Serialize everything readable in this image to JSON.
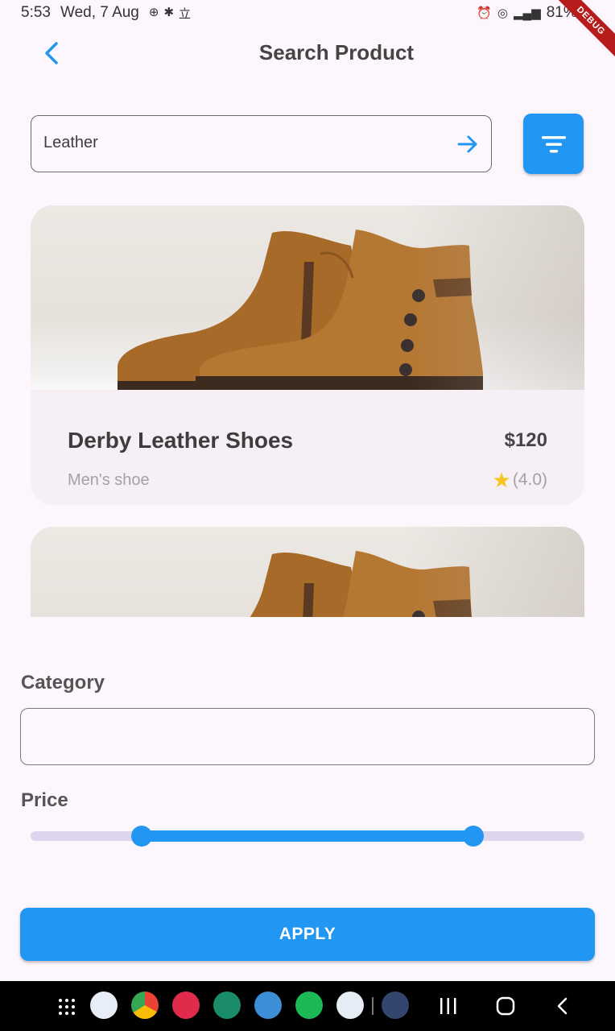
{
  "status_bar": {
    "time": "5:53",
    "date": "Wed, 7 Aug",
    "battery": "81%",
    "debug_banner": "DEBUG"
  },
  "app_bar": {
    "title": "Search Product",
    "back_icon": "chevron-left-icon"
  },
  "search": {
    "value": "Leather",
    "submit_icon": "arrow-right-icon",
    "filter_icon": "filter-icon"
  },
  "results": [
    {
      "name": "Derby Leather Shoes",
      "price": "$120",
      "subtitle": "Men's shoe",
      "rating": "(4.0)",
      "image": "brown-leather-ankle-boots"
    },
    {
      "image": "brown-leather-ankle-boots"
    }
  ],
  "filter": {
    "category_label": "Category",
    "category_value": "",
    "price_label": "Price",
    "price_range": {
      "start_fraction": 0.2,
      "end_fraction": 0.8
    },
    "apply_label": "APPLY"
  },
  "colors": {
    "primary": "#2196f3",
    "background": "#fdf6fc",
    "star": "#f7c520",
    "debug_banner": "#b71c1c"
  }
}
